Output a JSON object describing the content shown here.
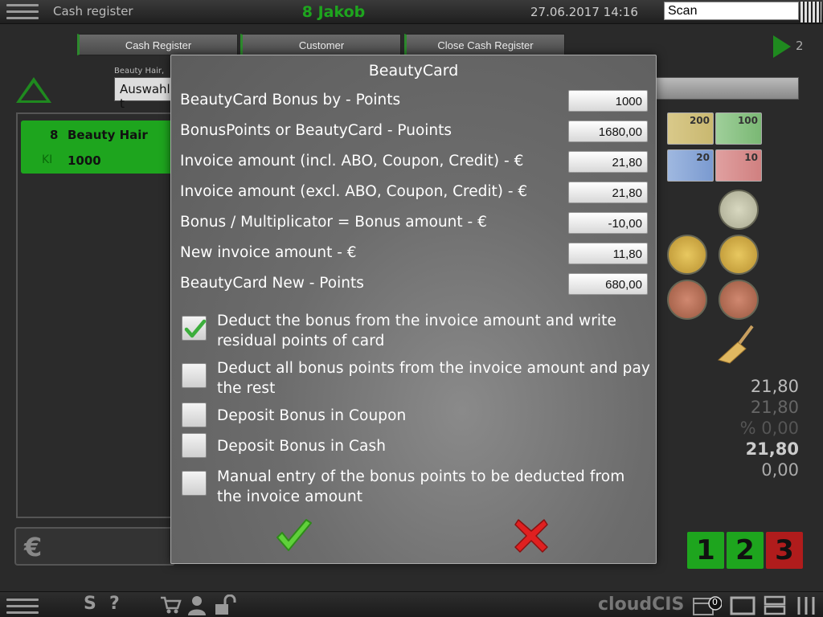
{
  "header": {
    "app_title": "Cash register",
    "user": "8 Jakob",
    "datetime": "27.06.2017 14:16",
    "scan_value": "Scan"
  },
  "tabs": [
    "Cash Register",
    "Customer",
    "Close Cash Register"
  ],
  "group": {
    "label": "Beauty Hair,",
    "select_value": "Auswahl t"
  },
  "play_count": "2",
  "list_item": {
    "qty": "8",
    "name": "Beauty Hair",
    "code": "KI",
    "price": "1000"
  },
  "euro_symbol": "€",
  "bills": [
    "200",
    "100",
    "20",
    "10"
  ],
  "totals": [
    "21,80",
    "21,80",
    "% 0,00",
    "21,80",
    "0,00"
  ],
  "number_buttons": [
    "1",
    "2",
    "3"
  ],
  "bottom": {
    "s_label": "S",
    "help_label": "?",
    "brand": "cloudCIS",
    "badge": "0"
  },
  "dialog": {
    "title": "BeautyCard",
    "rows": [
      {
        "label": "BeautyCard Bonus by - Points",
        "value": "1000"
      },
      {
        "label": "BonusPoints or BeautyCard - Puoints",
        "value": "1680,00"
      },
      {
        "label": "Invoice amount (incl. ABO, Coupon, Credit) - €",
        "value": "21,80"
      },
      {
        "label": "Invoice amount (excl. ABO, Coupon, Credit) - €",
        "value": "21,80"
      },
      {
        "label": "Bonus / Multiplicator = Bonus amount - €",
        "value": "-10,00"
      },
      {
        "label": "New invoice amount - €",
        "value": "11,80"
      },
      {
        "label": "BeautyCard New - Points",
        "value": "680,00"
      }
    ],
    "options": [
      {
        "label": "Deduct the bonus from the invoice amount and write residual points of card",
        "checked": true
      },
      {
        "label": "Deduct all bonus points from the invoice amount and pay the rest",
        "checked": false
      },
      {
        "label": "Deposit Bonus in Coupon",
        "checked": false
      },
      {
        "label": "Deposit Bonus in Cash",
        "checked": false
      },
      {
        "label": "Manual entry of the bonus points to be deducted from the invoice amount",
        "checked": false
      }
    ]
  },
  "colors": {
    "accent_green": "#1ea51e",
    "cancel_red": "#e02020",
    "btn3_red": "#b01c1c"
  }
}
